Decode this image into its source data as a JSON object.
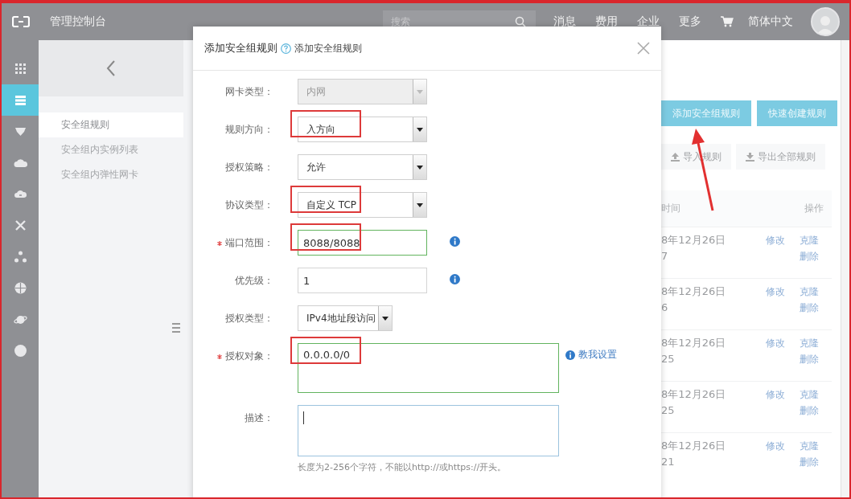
{
  "topbar": {
    "title": "管理控制台",
    "search": {
      "placeholder": "搜索"
    },
    "menu": [
      "消息",
      "费用",
      "企业",
      "更多"
    ],
    "language": "简体中文"
  },
  "rail": [
    {
      "selected": false
    },
    {
      "selected": true
    },
    {
      "selected": false
    },
    {
      "selected": false
    },
    {
      "selected": false
    },
    {
      "selected": false
    },
    {
      "selected": false
    },
    {
      "selected": false
    },
    {
      "selected": false
    },
    {
      "selected": false
    }
  ],
  "sidebar": {
    "items": [
      {
        "label": "安全组规则",
        "selected": true
      },
      {
        "label": "安全组内实例列表",
        "selected": false
      },
      {
        "label": "安全组内弹性网卡",
        "selected": false
      }
    ]
  },
  "main": {
    "buttons": [
      "添加安全组规则",
      "快速创建规则"
    ],
    "tools": [
      "导入规则",
      "导出全部规则"
    ],
    "table": {
      "columns": [
        "时间",
        "操作"
      ],
      "rows": [
        {
          "time": [
            "8年12月26日",
            "7"
          ],
          "actions": [
            "修改",
            "克隆",
            "删除"
          ]
        },
        {
          "time": [
            "8年12月26日",
            "6"
          ],
          "actions": [
            "修改",
            "克隆",
            "删除"
          ]
        },
        {
          "time": [
            "8年12月26日",
            "25"
          ],
          "actions": [
            "修改",
            "克隆",
            "删除"
          ]
        },
        {
          "time": [
            "8年12月26日",
            "25"
          ],
          "actions": [
            "修改",
            "克隆",
            "删除"
          ]
        },
        {
          "time": [
            "8年12月26日",
            "21"
          ],
          "actions": [
            "修改",
            "克隆",
            "删除"
          ]
        }
      ]
    }
  },
  "dialog": {
    "title": "添加安全组规则",
    "help": "添加安全组规则",
    "fields": [
      {
        "kind": "select",
        "label": "网卡类型：",
        "value": "内网",
        "disabled": true,
        "required": false
      },
      {
        "kind": "select",
        "label": "规则方向：",
        "value": "入方向",
        "disabled": false,
        "required": false,
        "highlighted": true
      },
      {
        "kind": "select",
        "label": "授权策略：",
        "value": "允许",
        "disabled": false,
        "required": false
      },
      {
        "kind": "select",
        "label": "协议类型：",
        "value": "自定义 TCP",
        "disabled": false,
        "required": false,
        "highlighted": true
      },
      {
        "kind": "input",
        "label": "端口范围：",
        "value": "8088/8088",
        "required": true,
        "valid": true,
        "highlighted": true,
        "info": true
      },
      {
        "kind": "input",
        "label": "优先级：",
        "value": "1",
        "required": false,
        "valid": false,
        "info": true
      },
      {
        "kind": "select",
        "label": "授权类型：",
        "value": "IPv4地址段访问",
        "disabled": false,
        "required": false,
        "narrow": true
      },
      {
        "kind": "textarea",
        "label": "授权对象：",
        "value": "0.0.0.0/0",
        "required": true,
        "valid": true,
        "highlighted": true,
        "link": "教我设置"
      },
      {
        "kind": "textarea",
        "label": "描述：",
        "required": false,
        "valid": false,
        "focused": true,
        "hint": "长度为2-256个字符，不能以http://或https://开头。"
      }
    ]
  }
}
